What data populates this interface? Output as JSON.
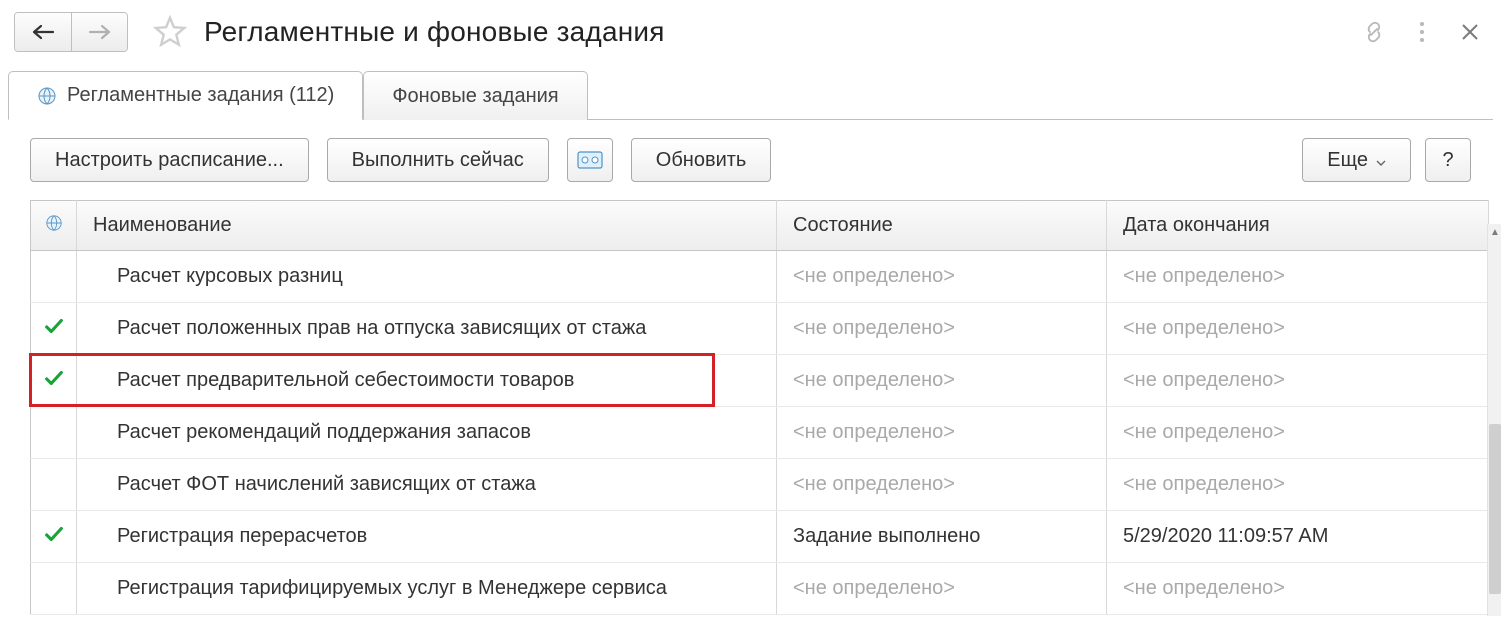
{
  "header": {
    "title": "Регламентные и фоновые задания"
  },
  "tabs": [
    {
      "label": "Регламентные задания (112)"
    },
    {
      "label": "Фоновые задания"
    }
  ],
  "toolbar": {
    "schedule": "Настроить расписание...",
    "run_now": "Выполнить сейчас",
    "refresh": "Обновить",
    "more": "Еще",
    "help": "?"
  },
  "columns": {
    "name": "Наименование",
    "state": "Состояние",
    "end_date": "Дата окончания"
  },
  "placeholder": "<не определено>",
  "rows": [
    {
      "check": false,
      "name": "Расчет курсовых разниц",
      "state": "<не определено>",
      "end": "<не определено>",
      "state_muted": true,
      "end_muted": true
    },
    {
      "check": true,
      "name": "Расчет положенных прав на отпуска зависящих от стажа",
      "state": "<не определено>",
      "end": "<не определено>",
      "state_muted": true,
      "end_muted": true
    },
    {
      "check": true,
      "name": "Расчет предварительной себестоимости товаров",
      "state": "<не определено>",
      "end": "<не определено>",
      "state_muted": true,
      "end_muted": true,
      "highlight": true
    },
    {
      "check": false,
      "name": "Расчет рекомендаций поддержания запасов",
      "state": "<не определено>",
      "end": "<не определено>",
      "state_muted": true,
      "end_muted": true
    },
    {
      "check": false,
      "name": "Расчет ФОТ начислений зависящих от стажа",
      "state": "<не определено>",
      "end": "<не определено>",
      "state_muted": true,
      "end_muted": true
    },
    {
      "check": true,
      "name": "Регистрация перерасчетов",
      "state": "Задание выполнено",
      "end": "5/29/2020 11:09:57 AM",
      "state_muted": false,
      "end_muted": false
    },
    {
      "check": false,
      "name": "Регистрация тарифицируемых услуг в Менеджере сервиса",
      "state": "<не определено>",
      "end": "<не определено>",
      "state_muted": true,
      "end_muted": true
    }
  ]
}
